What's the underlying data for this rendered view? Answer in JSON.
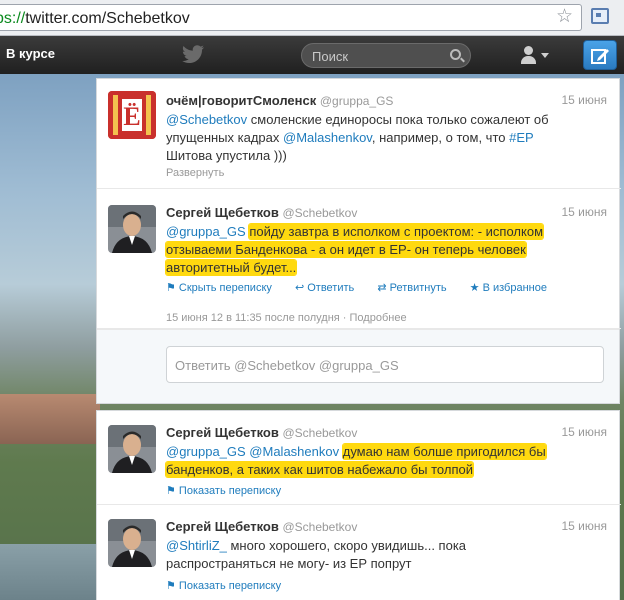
{
  "browser": {
    "url_scheme": "ps://",
    "url_rest": "twitter.com/Schebetkov"
  },
  "topbar": {
    "nav_label": "В курсе",
    "search_placeholder": "Поиск"
  },
  "tweets": [
    {
      "name": "очём|говоритСмоленск",
      "handle": "@gruppa_GS",
      "time": "15 июня",
      "line1_link": "@Schebetkov",
      "line1_text": " смоленские единоросы пока только сожалеют об",
      "line2_text": "упущенных кадрах ",
      "line2_link": "@Malashenkov",
      "line2_text2": ", например, о том, что ",
      "line2_hash": "#ЕР",
      "line3_text": "Шитова упустила )))",
      "expand": "Развернуть"
    },
    {
      "name": "Сергей Щебетков",
      "handle": "@Schebetkov",
      "time": "15 июня",
      "line1_link": "@gruppa_GS",
      "line1_hl": "пойду завтра в исполком с проектом: - исполком",
      "line2_hl": "отзываеми Банденкова - а он идет в ЕР- он теперь человек",
      "line3_hl": "авторитетный будет...",
      "actions": [
        "Скрыть переписку",
        "Ответить",
        "Ретвитнуть",
        "В избранное"
      ],
      "detail": "15 июня 12 в 11:35 после полудня · Подробнее",
      "reply_placeholder": "Ответить @Schebetkov @gruppa_GS"
    },
    {
      "name": "Сергей Щебетков",
      "handle": "@Schebetkov",
      "time": "15 июня",
      "line1_link": "@gruppa_GS @Malashenkov",
      "line1_hl": "думаю нам болше пригодился бы",
      "line2_hl": "банденков, а таких как шитов набежало бы толпой",
      "show": "Показать переписку"
    },
    {
      "name": "Сергей Щебетков",
      "handle": "@Schebetkov",
      "time": "15 июня",
      "line1_link": "@ShtirliZ_",
      "line1_text": " много хорошего, скоро увидишь... пока",
      "line2_text": "распространяться не могу- из ЕР попрут",
      "show": "Показать переписку"
    }
  ]
}
